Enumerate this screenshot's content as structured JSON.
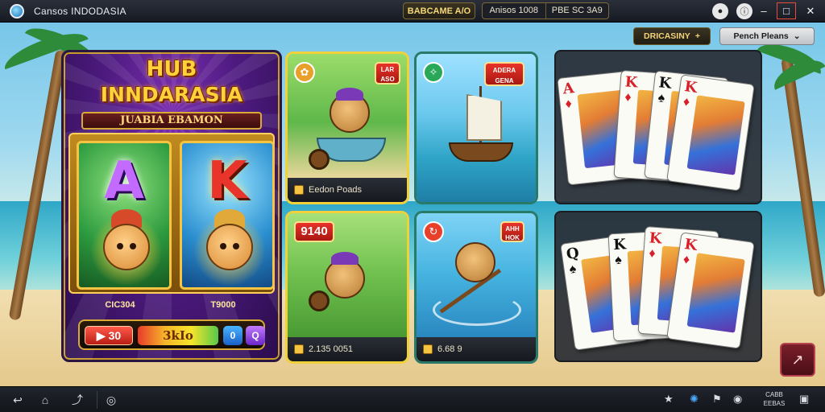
{
  "topbar": {
    "app_title": "Cansos INDODASIA",
    "balance": "BABCAME A/O",
    "group": [
      "Anisos 1008",
      "PBE SC 3A9"
    ],
    "icons": [
      "github-icon",
      "info-icon"
    ],
    "window_buttons": [
      "minimize",
      "maximize",
      "close"
    ]
  },
  "header": {
    "left_button": "DRICASINY",
    "left_button_icon": "plus-icon",
    "right_button": "Pench Pleans",
    "right_button_icon": "chevron-down-icon"
  },
  "hub": {
    "title_line1": "HUB",
    "title_line2": "INNDARASIA",
    "subtitle": "JUABIA EBAMON",
    "reels": [
      {
        "letter": "A",
        "value": "CIC304"
      },
      {
        "letter": "K",
        "value": "T9000"
      }
    ],
    "spin": {
      "label": "30",
      "icon": "play-icon"
    },
    "jackpot": "3kIo",
    "mini": [
      "0",
      "Q"
    ]
  },
  "tiles": [
    {
      "id": "tl",
      "icon": "leaf-icon",
      "tag": "LAR ASO",
      "footer": "Eedon Poads"
    },
    {
      "id": "tr",
      "icon": "compass-icon",
      "tag": "ADERA GENA",
      "footer": ""
    },
    {
      "id": "bl",
      "icon": "",
      "tag": "9140",
      "footer": "2.135 0051"
    },
    {
      "id": "br",
      "icon": "refresh-icon",
      "tag": "AHH HOK",
      "footer": "6.68   9"
    }
  ],
  "cards_top": [
    {
      "rank": "A",
      "suit": "♦",
      "color": "red"
    },
    {
      "rank": "K",
      "suit": "♦",
      "color": "red"
    },
    {
      "rank": "K",
      "suit": "♠",
      "color": "black"
    },
    {
      "rank": "K",
      "suit": "♦",
      "color": "red"
    }
  ],
  "cards_bottom": [
    {
      "rank": "Q",
      "suit": "♠",
      "color": "black"
    },
    {
      "rank": "K",
      "suit": "♠",
      "color": "black"
    },
    {
      "rank": "K",
      "suit": "♦",
      "color": "red"
    },
    {
      "rank": "K",
      "suit": "♦",
      "color": "red"
    }
  ],
  "share_button": "↗",
  "taskbar": {
    "left_icons": [
      "back-icon",
      "home-icon",
      "recent-icon",
      "settings-icon"
    ],
    "right_icons": [
      "star-icon",
      "chrome-icon",
      "flag-icon",
      "wifi-icon",
      "battery-icon"
    ],
    "clock_line1": "CABB",
    "clock_line2": "EEBAS"
  },
  "colors": {
    "accent_gold": "#f1d13a",
    "hub_purple": "#4d1a7f",
    "spin_red": "#e8332a"
  }
}
